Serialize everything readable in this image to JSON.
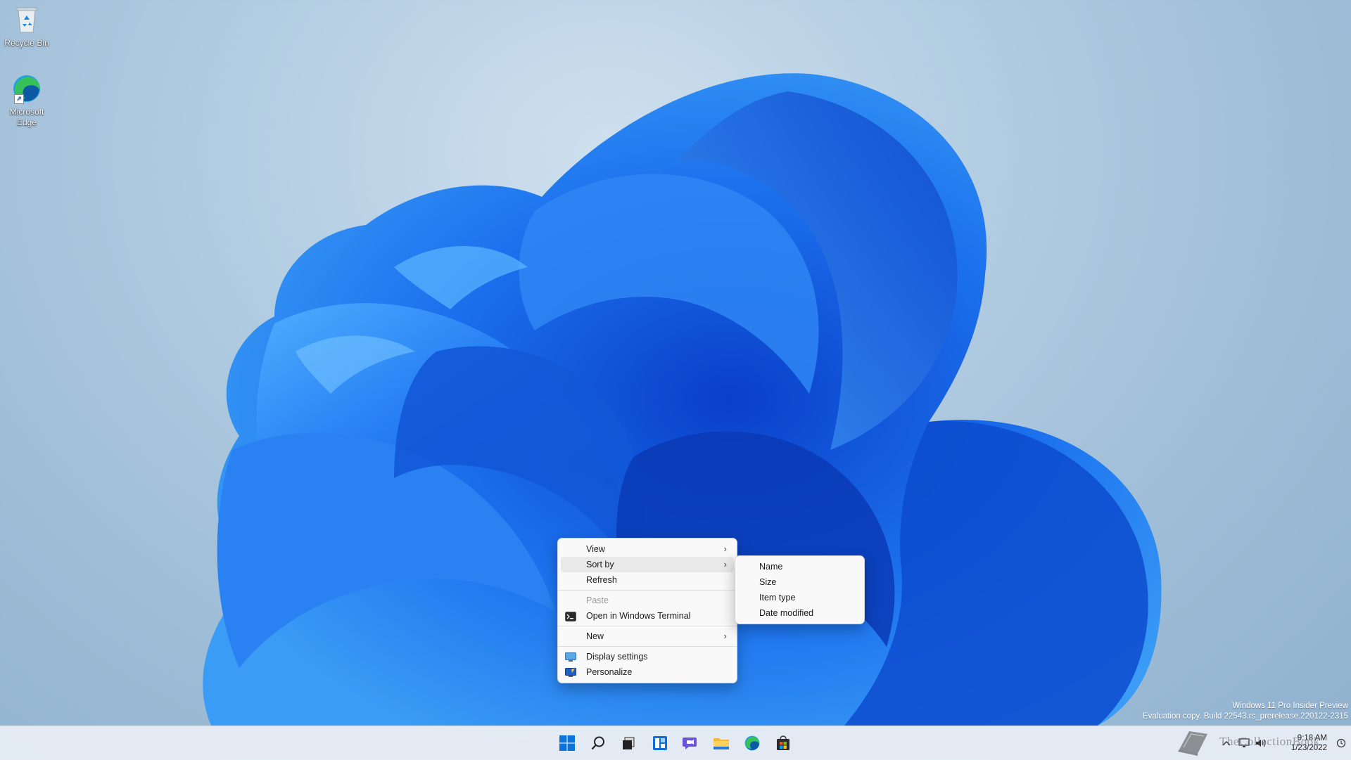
{
  "desktop": {
    "icons": [
      {
        "label": "Recycle Bin",
        "icon": "recycle-bin-icon"
      },
      {
        "label": "Microsoft Edge",
        "icon": "edge-icon"
      }
    ]
  },
  "context_menu": {
    "items": [
      {
        "label": "View",
        "submenu": true
      },
      {
        "label": "Sort by",
        "submenu": true,
        "highlighted": true
      },
      {
        "label": "Refresh"
      },
      {
        "label": "Paste",
        "disabled": true
      },
      {
        "label": "Open in Windows Terminal",
        "icon": "terminal-icon"
      },
      {
        "label": "New",
        "submenu": true
      },
      {
        "label": "Display settings",
        "icon": "display-icon"
      },
      {
        "label": "Personalize",
        "icon": "personalize-icon"
      }
    ],
    "submenu_arrow": "›"
  },
  "sort_submenu": {
    "items": [
      "Name",
      "Size",
      "Item type",
      "Date modified"
    ]
  },
  "watermark": {
    "line1": "Windows 11 Pro Insider Preview",
    "line2": "Evaluation copy. Build 22543.rs_prerelease.220122-2315"
  },
  "taskbar": {
    "apps": [
      "start-icon",
      "search-icon",
      "task-view-icon",
      "widgets-icon",
      "chat-icon",
      "file-explorer-icon",
      "edge-icon",
      "store-icon"
    ],
    "clock_time": "9:18 AM",
    "clock_date": "1/23/2022",
    "tray_icons": [
      "chevron-up-icon",
      "network-icon",
      "volume-icon"
    ],
    "brand_text": "TheCollectionBook"
  },
  "colors": {
    "accent": "#0067c0",
    "wallpaper_blue": "#1565e6"
  }
}
